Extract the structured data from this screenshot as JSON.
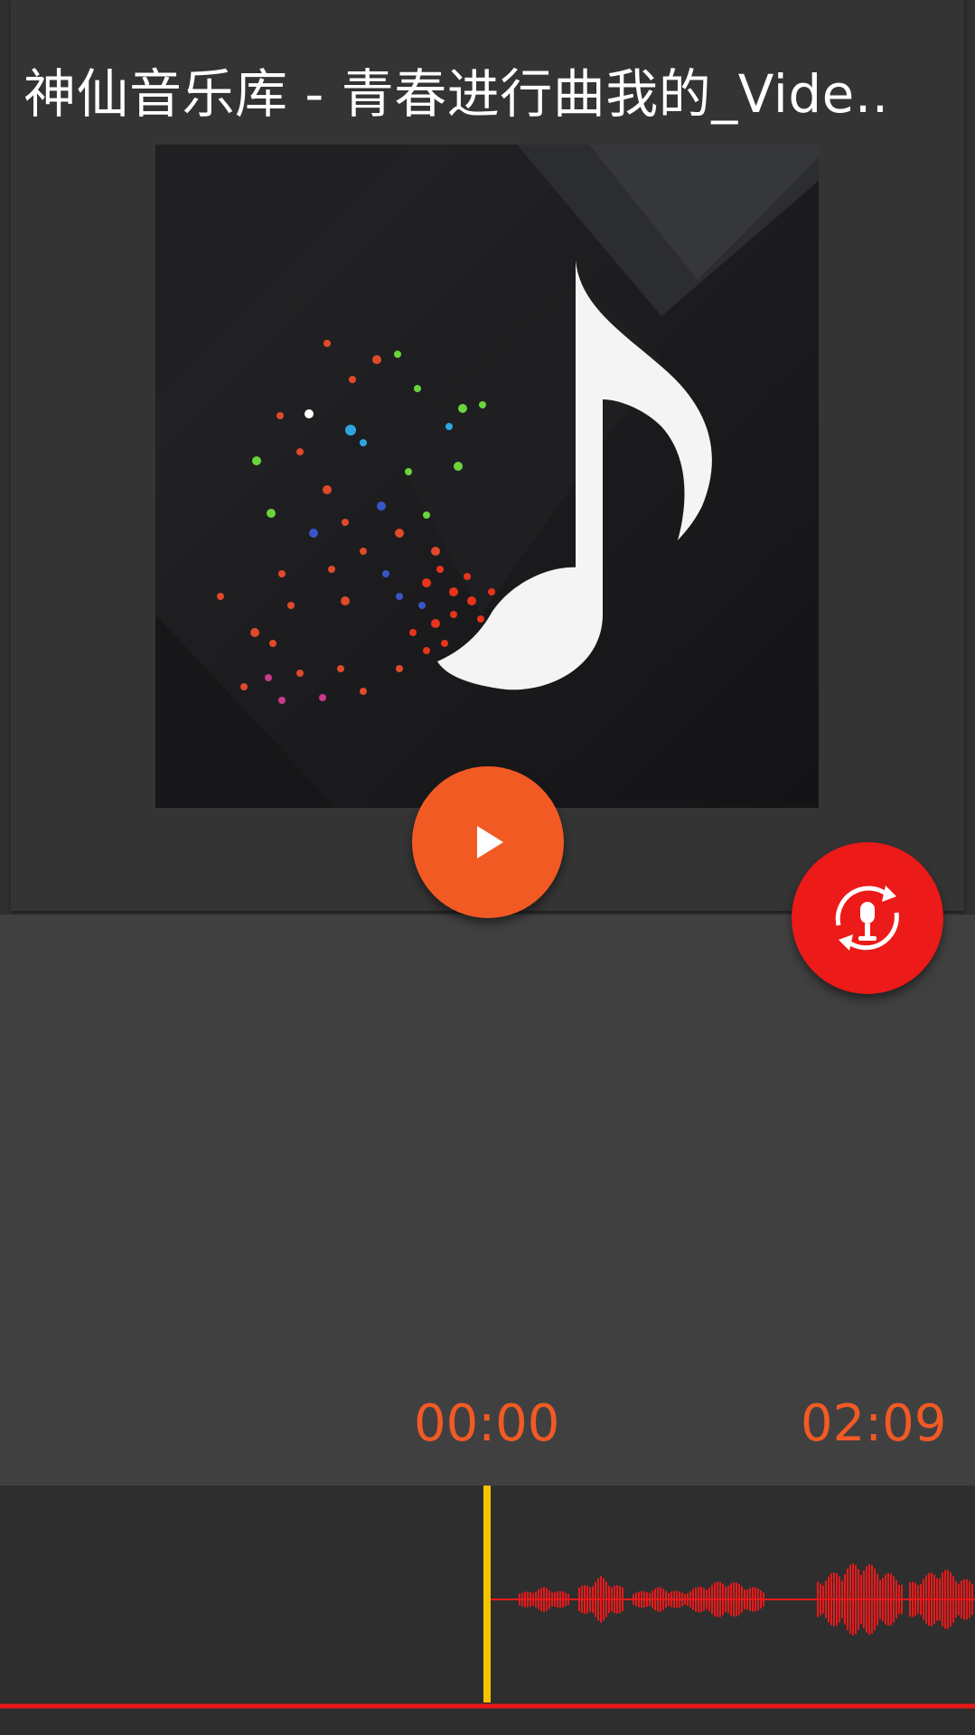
{
  "player": {
    "title": "神仙音乐库 - 青春进行曲我的_Vide..",
    "current_time": "00:00",
    "total_time": "02:09"
  },
  "icons": {
    "album_art": "music-note-artwork",
    "play": "play-icon",
    "voice_change": "microphone-rotate-icon"
  },
  "colors": {
    "accent": "#f25a24",
    "fab_red": "#ec1a18",
    "waveform": "#e8191a",
    "playhead": "#f5c400"
  }
}
